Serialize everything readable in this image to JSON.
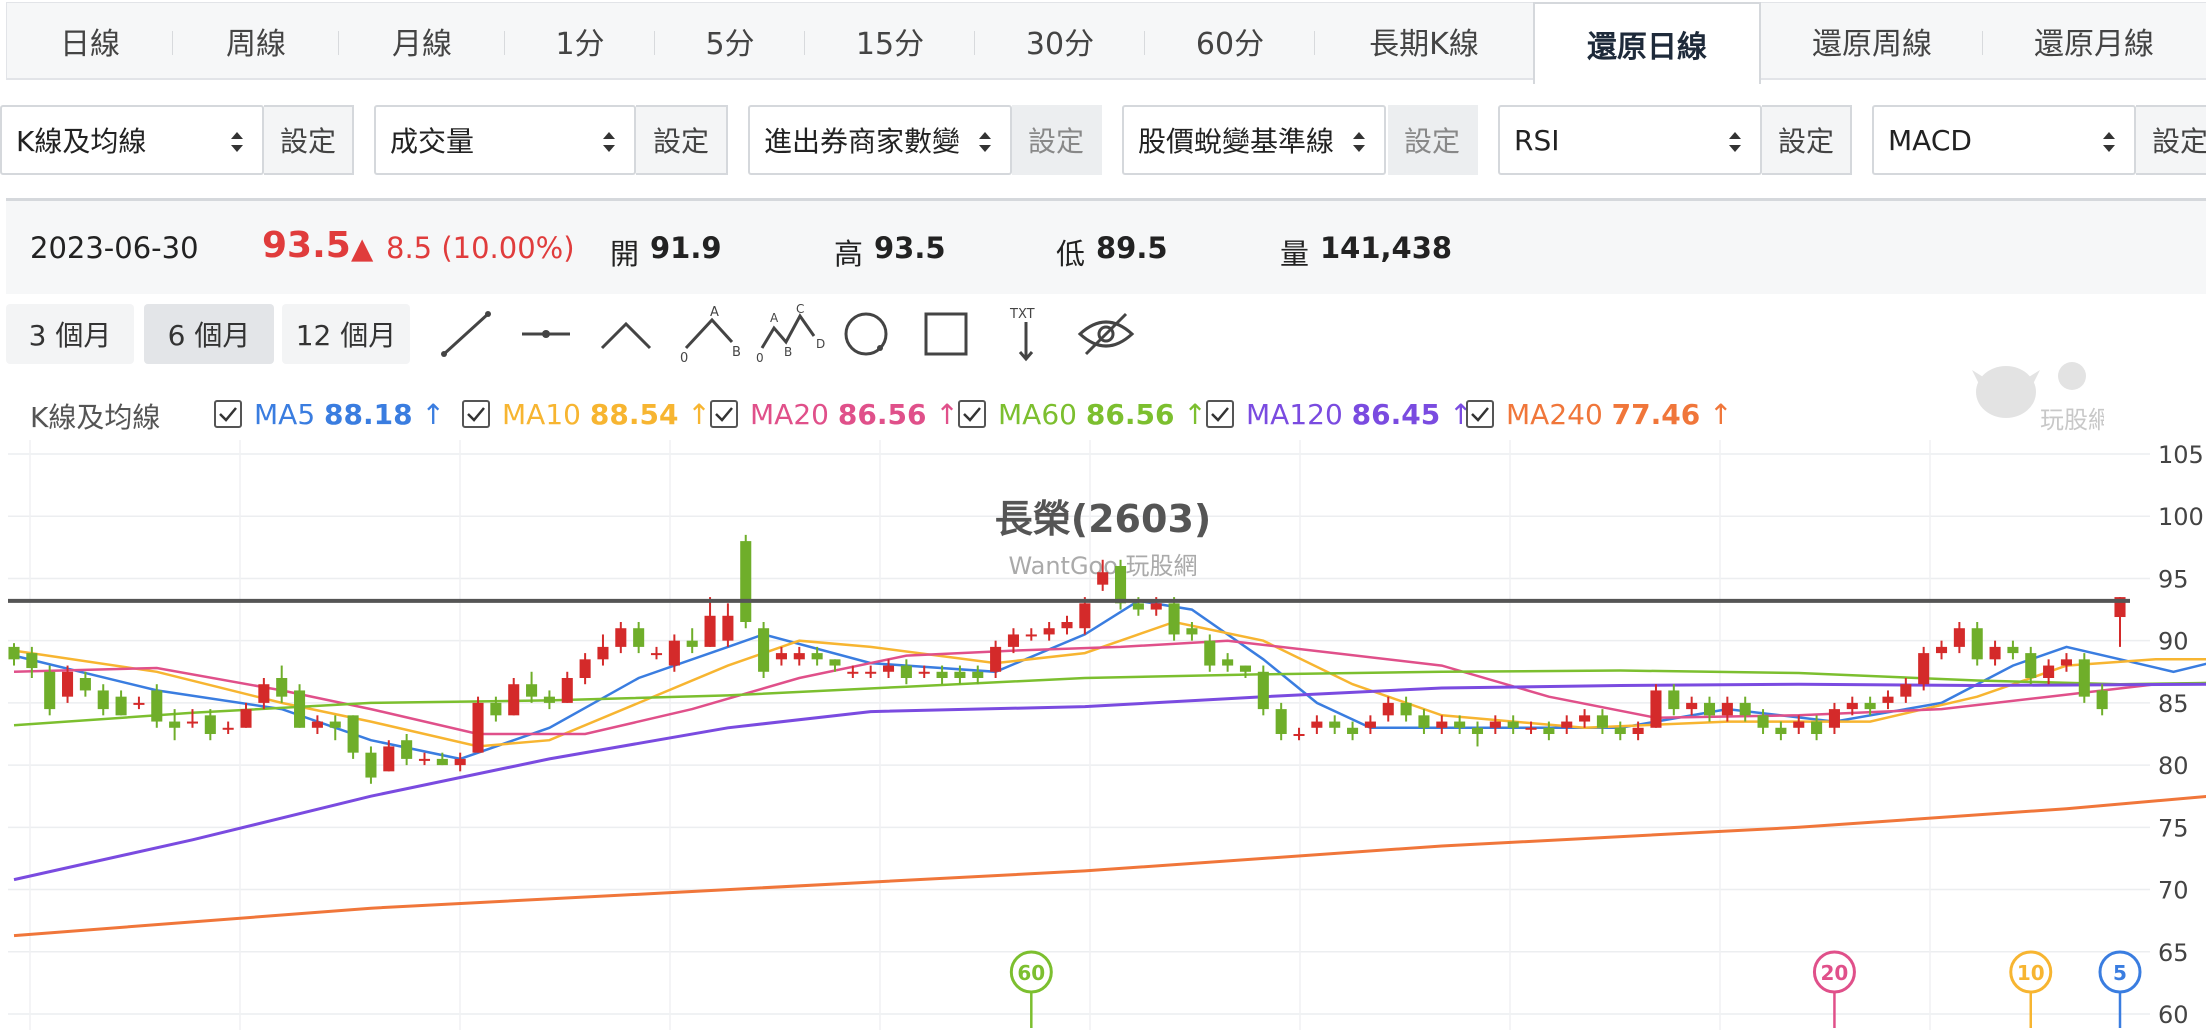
{
  "tabs": [
    "日線",
    "周線",
    "月線",
    "1分",
    "5分",
    "15分",
    "30分",
    "60分",
    "長期K線",
    "還原日線",
    "還原周線",
    "還原月線"
  ],
  "active_tab": "還原日線",
  "selectors": [
    {
      "value": "K線及均線",
      "button": "設定"
    },
    {
      "value": "成交量",
      "button": "設定"
    },
    {
      "value": "進出券商家數變",
      "button": "設定"
    },
    {
      "value": "股價蛻變基準線",
      "button": "設定"
    },
    {
      "value": "RSI",
      "button": "設定"
    },
    {
      "value": "MACD",
      "button": "設定"
    }
  ],
  "quote": {
    "date": "2023-06-30",
    "price": "93.5",
    "change": "8.5 (10.00%)",
    "open_label": "開",
    "open": "91.9",
    "high_label": "高",
    "high": "93.5",
    "low_label": "低",
    "low": "89.5",
    "volume_label": "量",
    "volume": "141,438"
  },
  "ranges": [
    "3 個月",
    "6 個月",
    "12 個月"
  ],
  "active_range": "6 個月",
  "tool_labels": {
    "abc_a": "A",
    "abc_b": "B",
    "abc_0": "0",
    "wave_c": "C",
    "wave_a": "A",
    "wave_b": "B",
    "wave_d": "D",
    "wave_0": "0",
    "text": "TXT"
  },
  "legend": {
    "title": "K線及均線",
    "items": [
      {
        "name": "MA5",
        "value": "88.18",
        "dir": "↑",
        "color": "#3a7de0"
      },
      {
        "name": "MA10",
        "value": "88.54",
        "dir": "↑",
        "color": "#f7b531"
      },
      {
        "name": "MA20",
        "value": "86.56",
        "dir": "↑",
        "color": "#e0508a"
      },
      {
        "name": "MA60",
        "value": "86.56",
        "dir": "↑",
        "color": "#7cbf2f"
      },
      {
        "name": "MA120",
        "value": "86.45",
        "dir": "↑",
        "color": "#7a4be0"
      },
      {
        "name": "MA240",
        "value": "77.46",
        "dir": "↑",
        "color": "#f0763a"
      }
    ]
  },
  "watermark": {
    "name": "長榮(2603)",
    "site": "WantGoo 玩股網",
    "logo_text": "玩股網"
  },
  "chart_data": {
    "type": "candlestick",
    "title": "長榮(2603)",
    "ylim": [
      60,
      105
    ],
    "yticks": [
      105,
      100,
      95,
      90,
      85,
      80,
      75,
      70,
      65,
      60
    ],
    "reference_line": 93.2,
    "up_color": "#d42a2a",
    "down_color": "#6fae2a",
    "candles": [
      [
        89.5,
        88.5,
        89.8,
        88.0
      ],
      [
        89.0,
        87.8,
        89.5,
        87.0
      ],
      [
        87.5,
        84.5,
        88.0,
        84.0
      ],
      [
        85.5,
        87.5,
        88.0,
        85.0
      ],
      [
        87.0,
        86.0,
        87.5,
        85.5
      ],
      [
        86.0,
        84.5,
        86.5,
        84.0
      ],
      [
        85.5,
        84.0,
        86.0,
        84.0
      ],
      [
        85.0,
        85.0,
        85.5,
        84.5
      ],
      [
        86.0,
        83.5,
        86.5,
        83.0
      ],
      [
        83.5,
        83.0,
        84.5,
        82.0
      ],
      [
        83.5,
        83.5,
        84.5,
        83.0
      ],
      [
        84.0,
        82.5,
        84.5,
        82.0
      ],
      [
        83.0,
        83.0,
        83.5,
        82.5
      ],
      [
        83.0,
        84.5,
        85.0,
        83.0
      ],
      [
        85.0,
        86.5,
        87.0,
        84.5
      ],
      [
        87.0,
        85.5,
        88.0,
        85.0
      ],
      [
        86.0,
        83.0,
        86.5,
        83.0
      ],
      [
        83.0,
        83.5,
        84.0,
        82.5
      ],
      [
        83.5,
        83.0,
        84.0,
        82.0
      ],
      [
        84.0,
        81.0,
        84.0,
        80.5
      ],
      [
        81.0,
        79.0,
        81.5,
        78.5
      ],
      [
        79.5,
        81.5,
        82.0,
        79.5
      ],
      [
        82.0,
        80.5,
        82.5,
        80.0
      ],
      [
        80.5,
        80.5,
        81.0,
        80.0
      ],
      [
        80.5,
        80.0,
        81.0,
        80.0
      ],
      [
        80.0,
        80.5,
        81.0,
        79.5
      ],
      [
        81.0,
        85.0,
        85.5,
        81.0
      ],
      [
        85.0,
        84.0,
        85.5,
        83.5
      ],
      [
        84.0,
        86.5,
        87.0,
        84.0
      ],
      [
        86.5,
        85.5,
        87.5,
        85.0
      ],
      [
        85.5,
        85.0,
        86.0,
        84.5
      ],
      [
        85.0,
        87.0,
        87.5,
        85.0
      ],
      [
        87.0,
        88.5,
        89.0,
        86.5
      ],
      [
        88.5,
        89.5,
        90.5,
        88.0
      ],
      [
        89.5,
        91.0,
        91.5,
        89.0
      ],
      [
        91.0,
        89.5,
        91.5,
        89.0
      ],
      [
        89.0,
        89.0,
        89.5,
        88.5
      ],
      [
        88.0,
        90.0,
        90.5,
        87.5
      ],
      [
        90.0,
        89.5,
        91.0,
        89.0
      ],
      [
        89.5,
        92.0,
        93.5,
        89.5
      ],
      [
        90.0,
        92.0,
        93.0,
        89.5
      ],
      [
        98.0,
        91.5,
        98.5,
        91.0
      ],
      [
        91.0,
        87.5,
        91.5,
        87.0
      ],
      [
        88.5,
        89.0,
        89.5,
        88.0
      ],
      [
        88.5,
        89.0,
        89.5,
        88.0
      ],
      [
        89.0,
        88.5,
        89.5,
        88.0
      ],
      [
        88.5,
        88.0,
        88.5,
        87.5
      ],
      [
        87.5,
        87.5,
        88.0,
        87.0
      ],
      [
        87.5,
        87.5,
        88.0,
        87.0
      ],
      [
        87.5,
        88.0,
        88.5,
        87.0
      ],
      [
        88.0,
        87.0,
        88.5,
        86.5
      ],
      [
        87.5,
        87.5,
        88.0,
        87.0
      ],
      [
        87.5,
        87.0,
        88.0,
        86.5
      ],
      [
        87.5,
        87.0,
        88.0,
        86.5
      ],
      [
        87.5,
        87.0,
        88.0,
        86.5
      ],
      [
        87.5,
        89.5,
        90.0,
        87.0
      ],
      [
        89.5,
        90.5,
        91.0,
        89.0
      ],
      [
        90.5,
        90.5,
        91.0,
        90.0
      ],
      [
        90.5,
        91.0,
        91.5,
        90.0
      ],
      [
        91.0,
        91.5,
        92.0,
        90.5
      ],
      [
        91.0,
        93.0,
        93.5,
        90.5
      ],
      [
        94.5,
        95.5,
        96.5,
        94.0
      ],
      [
        96.0,
        93.0,
        96.5,
        92.5
      ],
      [
        93.0,
        92.5,
        93.5,
        92.0
      ],
      [
        92.5,
        93.0,
        93.5,
        92.0
      ],
      [
        93.0,
        90.5,
        93.5,
        90.0
      ],
      [
        91.0,
        90.5,
        91.5,
        90.0
      ],
      [
        90.0,
        88.0,
        90.5,
        87.5
      ],
      [
        88.5,
        88.0,
        89.0,
        87.5
      ],
      [
        88.0,
        87.5,
        88.0,
        87.0
      ],
      [
        87.5,
        84.5,
        88.0,
        84.0
      ],
      [
        84.5,
        82.5,
        85.0,
        82.0
      ],
      [
        82.5,
        82.5,
        83.0,
        82.0
      ],
      [
        83.0,
        83.5,
        84.0,
        82.5
      ],
      [
        83.5,
        83.0,
        84.0,
        82.5
      ],
      [
        83.0,
        82.5,
        83.5,
        82.0
      ],
      [
        83.0,
        83.5,
        84.0,
        82.5
      ],
      [
        84.0,
        85.0,
        85.5,
        83.5
      ],
      [
        85.0,
        84.0,
        85.5,
        83.5
      ],
      [
        84.0,
        83.0,
        84.5,
        82.5
      ],
      [
        83.0,
        83.5,
        84.0,
        82.5
      ],
      [
        83.5,
        83.0,
        84.0,
        82.5
      ],
      [
        83.0,
        82.5,
        83.5,
        81.5
      ],
      [
        83.0,
        83.5,
        84.0,
        82.5
      ],
      [
        83.5,
        83.0,
        84.0,
        82.5
      ],
      [
        83.0,
        83.0,
        83.5,
        82.5
      ],
      [
        83.0,
        82.5,
        83.5,
        82.0
      ],
      [
        83.0,
        83.5,
        84.0,
        82.5
      ],
      [
        83.5,
        84.0,
        84.5,
        83.0
      ],
      [
        84.0,
        83.0,
        84.5,
        82.5
      ],
      [
        83.0,
        82.5,
        83.5,
        82.0
      ],
      [
        82.5,
        83.0,
        83.5,
        82.0
      ],
      [
        83.0,
        86.0,
        86.5,
        83.0
      ],
      [
        86.0,
        84.5,
        86.5,
        84.0
      ],
      [
        84.5,
        85.0,
        85.5,
        84.0
      ],
      [
        85.0,
        84.0,
        85.5,
        83.5
      ],
      [
        84.0,
        85.0,
        85.5,
        83.5
      ],
      [
        85.0,
        84.0,
        85.5,
        83.5
      ],
      [
        84.0,
        83.0,
        84.5,
        82.5
      ],
      [
        83.0,
        82.5,
        83.5,
        82.0
      ],
      [
        83.0,
        83.5,
        84.0,
        82.5
      ],
      [
        83.5,
        82.5,
        84.0,
        82.0
      ],
      [
        83.0,
        84.5,
        85.0,
        82.5
      ],
      [
        84.5,
        85.0,
        85.5,
        84.0
      ],
      [
        85.0,
        84.5,
        85.5,
        84.0
      ],
      [
        85.0,
        85.5,
        86.0,
        84.5
      ],
      [
        85.5,
        86.5,
        87.0,
        85.0
      ],
      [
        86.5,
        89.0,
        89.5,
        86.0
      ],
      [
        89.0,
        89.5,
        90.0,
        88.5
      ],
      [
        89.5,
        91.0,
        91.5,
        89.0
      ],
      [
        91.0,
        88.5,
        91.5,
        88.0
      ],
      [
        88.5,
        89.5,
        90.0,
        88.0
      ],
      [
        89.5,
        89.0,
        90.0,
        88.5
      ],
      [
        89.0,
        87.0,
        89.5,
        86.5
      ],
      [
        87.0,
        88.0,
        88.5,
        86.5
      ],
      [
        88.0,
        88.5,
        89.0,
        87.5
      ],
      [
        88.5,
        85.5,
        89.0,
        85.0
      ],
      [
        86.0,
        84.5,
        86.5,
        84.0
      ],
      [
        91.9,
        93.5,
        93.5,
        89.5
      ]
    ],
    "series": [
      {
        "name": "MA5",
        "color": "#3a7de0",
        "values": [
          [
            0,
            88.8
          ],
          [
            8,
            86.0
          ],
          [
            15,
            84.5
          ],
          [
            20,
            82.0
          ],
          [
            25,
            80.5
          ],
          [
            30,
            83.0
          ],
          [
            35,
            87.0
          ],
          [
            40,
            89.5
          ],
          [
            42,
            90.5
          ],
          [
            48,
            88.2
          ],
          [
            55,
            87.5
          ],
          [
            60,
            90.5
          ],
          [
            63,
            93.2
          ],
          [
            66,
            92.5
          ],
          [
            70,
            88.5
          ],
          [
            73,
            85.0
          ],
          [
            76,
            83.0
          ],
          [
            82,
            83.0
          ],
          [
            90,
            83.0
          ],
          [
            96,
            84.5
          ],
          [
            102,
            83.5
          ],
          [
            108,
            85.0
          ],
          [
            112,
            88.0
          ],
          [
            115,
            89.5
          ],
          [
            118,
            88.5
          ],
          [
            121,
            87.5
          ],
          [
            123,
            88.2
          ]
        ]
      },
      {
        "name": "MA10",
        "color": "#f7b531",
        "values": [
          [
            0,
            89.2
          ],
          [
            8,
            87.5
          ],
          [
            15,
            85.0
          ],
          [
            20,
            83.5
          ],
          [
            26,
            81.5
          ],
          [
            30,
            82.0
          ],
          [
            35,
            85.0
          ],
          [
            40,
            88.0
          ],
          [
            44,
            90.0
          ],
          [
            48,
            89.5
          ],
          [
            55,
            88.2
          ],
          [
            60,
            89.0
          ],
          [
            65,
            91.5
          ],
          [
            70,
            90.0
          ],
          [
            75,
            86.5
          ],
          [
            80,
            84.0
          ],
          [
            88,
            83.0
          ],
          [
            96,
            83.5
          ],
          [
            104,
            83.5
          ],
          [
            110,
            85.5
          ],
          [
            115,
            88.0
          ],
          [
            120,
            88.5
          ],
          [
            123,
            88.5
          ]
        ]
      },
      {
        "name": "MA20",
        "color": "#e0508a",
        "values": [
          [
            0,
            87.5
          ],
          [
            8,
            87.8
          ],
          [
            15,
            86.0
          ],
          [
            20,
            84.5
          ],
          [
            26,
            82.5
          ],
          [
            32,
            82.5
          ],
          [
            38,
            84.5
          ],
          [
            44,
            87.0
          ],
          [
            50,
            88.8
          ],
          [
            56,
            89.2
          ],
          [
            62,
            89.5
          ],
          [
            68,
            90.0
          ],
          [
            74,
            89.0
          ],
          [
            80,
            88.0
          ],
          [
            86,
            85.5
          ],
          [
            92,
            83.8
          ],
          [
            100,
            84.0
          ],
          [
            108,
            84.5
          ],
          [
            114,
            85.5
          ],
          [
            120,
            86.5
          ],
          [
            123,
            86.6
          ]
        ]
      },
      {
        "name": "MA60",
        "color": "#7cbf2f",
        "values": [
          [
            0,
            83.2
          ],
          [
            10,
            84.2
          ],
          [
            20,
            85.0
          ],
          [
            30,
            85.2
          ],
          [
            40,
            85.6
          ],
          [
            50,
            86.3
          ],
          [
            60,
            87.0
          ],
          [
            70,
            87.3
          ],
          [
            80,
            87.5
          ],
          [
            90,
            87.6
          ],
          [
            100,
            87.4
          ],
          [
            110,
            86.8
          ],
          [
            118,
            86.5
          ],
          [
            123,
            86.6
          ]
        ]
      },
      {
        "name": "MA120",
        "color": "#7a4be0",
        "values": [
          [
            0,
            70.8
          ],
          [
            10,
            74.0
          ],
          [
            20,
            77.5
          ],
          [
            30,
            80.5
          ],
          [
            40,
            83.0
          ],
          [
            48,
            84.3
          ],
          [
            60,
            84.7
          ],
          [
            70,
            85.5
          ],
          [
            80,
            86.2
          ],
          [
            90,
            86.4
          ],
          [
            100,
            86.5
          ],
          [
            110,
            86.4
          ],
          [
            123,
            86.5
          ]
        ]
      },
      {
        "name": "MA240",
        "color": "#f0763a",
        "values": [
          [
            0,
            66.3
          ],
          [
            20,
            68.5
          ],
          [
            40,
            70.0
          ],
          [
            60,
            71.5
          ],
          [
            80,
            73.5
          ],
          [
            100,
            75.0
          ],
          [
            115,
            76.5
          ],
          [
            123,
            77.5
          ]
        ]
      }
    ],
    "markers": [
      {
        "label": "60",
        "index": 57,
        "color": "#7cbf2f"
      },
      {
        "label": "20",
        "index": 102,
        "color": "#e0508a"
      },
      {
        "label": "10",
        "index": 113,
        "color": "#f7b531"
      },
      {
        "label": "5",
        "index": 118,
        "color": "#3a7de0"
      }
    ]
  }
}
